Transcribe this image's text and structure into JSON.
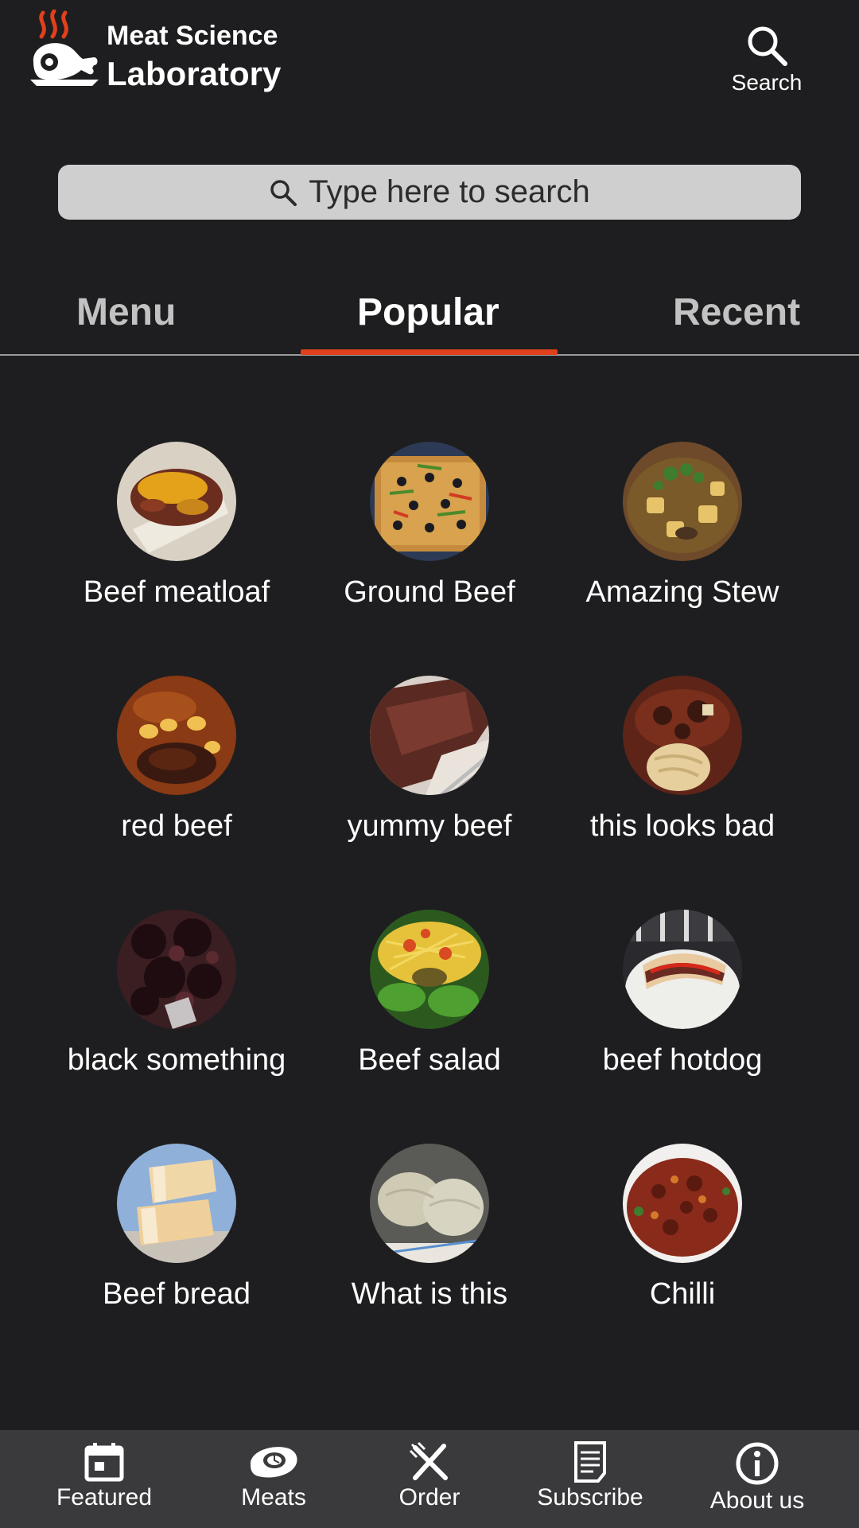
{
  "header": {
    "brand_line1": "Meat Science",
    "brand_line2": "Laboratory",
    "search_label": "Search",
    "logo_icon": "steaming-meat-logo"
  },
  "search": {
    "placeholder": "Type here to search"
  },
  "tabs": [
    {
      "label": "Menu",
      "active": false
    },
    {
      "label": "Popular",
      "active": true
    },
    {
      "label": "Recent",
      "active": false
    }
  ],
  "items": [
    {
      "name": "Beef meatloaf",
      "thumb": "meatloaf-photo"
    },
    {
      "name": "Ground Beef",
      "thumb": "pizza-photo"
    },
    {
      "name": "Amazing Stew",
      "thumb": "stew-photo"
    },
    {
      "name": "red beef",
      "thumb": "roasted-beef-photo"
    },
    {
      "name": "yummy beef",
      "thumb": "sliced-steak-photo"
    },
    {
      "name": "this looks bad",
      "thumb": "beef-pasta-photo"
    },
    {
      "name": "black something",
      "thumb": "dark-meat-photo"
    },
    {
      "name": "Beef salad",
      "thumb": "salad-photo"
    },
    {
      "name": "beef hotdog",
      "thumb": "hotdog-photo"
    },
    {
      "name": "Beef bread",
      "thumb": "pastry-rolls-photo"
    },
    {
      "name": "What is this",
      "thumb": "cabbage-rolls-photo"
    },
    {
      "name": "Chilli",
      "thumb": "chili-bowl-photo"
    }
  ],
  "bottom_nav": [
    {
      "label": "Featured",
      "icon": "calendar-icon"
    },
    {
      "label": "Meats",
      "icon": "steak-icon"
    },
    {
      "label": "Order",
      "icon": "fork-knife-icon"
    },
    {
      "label": "Subscribe",
      "icon": "document-icon"
    },
    {
      "label": "About us",
      "icon": "info-icon"
    }
  ],
  "colors": {
    "background": "#1e1e20",
    "accent": "#e0401c",
    "search_bg": "#cfcfcf",
    "nav_bg": "#3a3a3c"
  }
}
